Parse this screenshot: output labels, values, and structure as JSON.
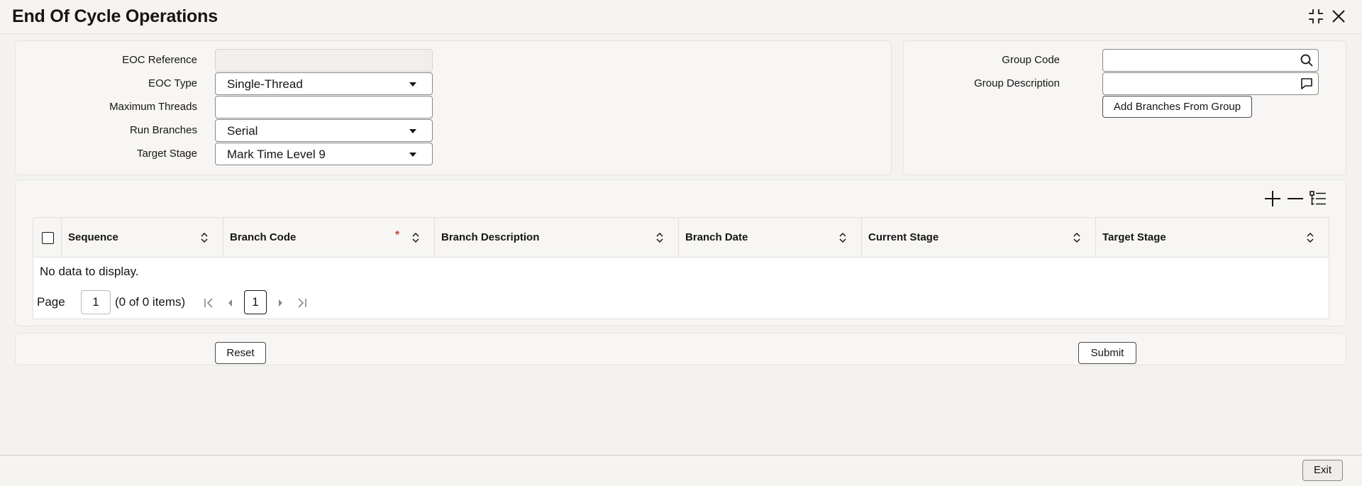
{
  "window": {
    "title": "End Of Cycle Operations",
    "icons": [
      "collapse-icon",
      "close-icon"
    ]
  },
  "form": {
    "eoc_reference": {
      "label": "EOC Reference",
      "value": ""
    },
    "eoc_type": {
      "label": "EOC Type",
      "value": "Single-Thread"
    },
    "maximum_threads": {
      "label": "Maximum Threads",
      "value": ""
    },
    "run_branches": {
      "label": "Run Branches",
      "value": "Serial"
    },
    "target_stage": {
      "label": "Target Stage",
      "value": "Mark Time Level 9"
    }
  },
  "group": {
    "group_code": {
      "label": "Group Code",
      "value": "",
      "icon": "search-icon"
    },
    "group_description": {
      "label": "Group Description",
      "value": "",
      "icon": "comment-icon"
    },
    "add_branches_label": "Add Branches From Group"
  },
  "grid": {
    "toolbar_icons": [
      "add-row-icon",
      "delete-row-icon",
      "single-record-view-icon"
    ],
    "columns": [
      {
        "label": "Sequence",
        "required": false
      },
      {
        "label": "Branch Code",
        "required": true,
        "required_mark": "*"
      },
      {
        "label": "Branch Description",
        "required": false
      },
      {
        "label": "Branch Date",
        "required": false
      },
      {
        "label": "Current Stage",
        "required": false
      },
      {
        "label": "Target Stage",
        "required": false
      }
    ],
    "rows": [],
    "empty_message": "No data to display.",
    "pagination": {
      "page_label": "Page",
      "page_value": "1",
      "items_text": "(0 of 0 items)",
      "current_page": "1"
    }
  },
  "actions": {
    "reset_label": "Reset",
    "submit_label": "Submit"
  },
  "footer": {
    "exit_label": "Exit"
  },
  "colors": {
    "background": "#f4f2ef",
    "panel": "#f7f6f4",
    "required": "#c74634",
    "text": "#161513"
  }
}
